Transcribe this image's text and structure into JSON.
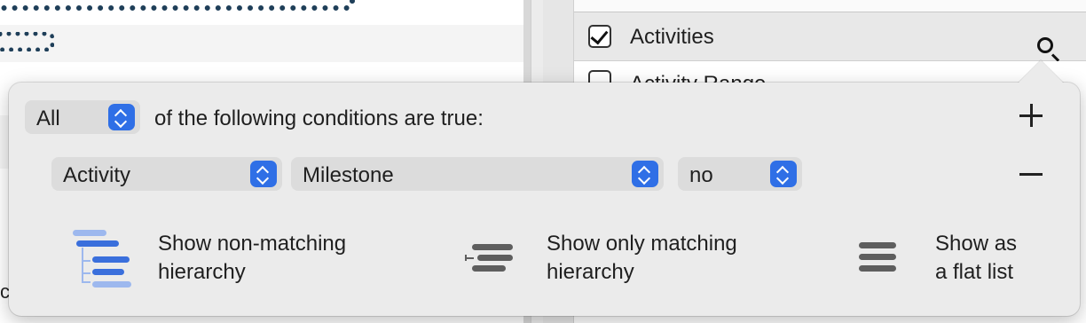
{
  "background": {
    "filter_list": {
      "active_item": "Activities",
      "active_checked": true,
      "next_item": "Activity Range"
    },
    "cut_text": "c"
  },
  "popover": {
    "quantifier": {
      "value": "All"
    },
    "conditions_text": "of the following conditions are true:",
    "rule": {
      "field": "Activity",
      "property": "Milestone",
      "value": "no"
    },
    "add_icon": "plus-icon",
    "remove_icon": "minus-icon",
    "display_options": [
      {
        "label_line1": "Show non-matching",
        "label_line2": "hierarchy",
        "icon": "hierarchy-outline-icon",
        "selected": true
      },
      {
        "label_line1": "Show only matching",
        "label_line2": "hierarchy",
        "icon": "matching-hierarchy-icon",
        "selected": false
      },
      {
        "label_line1": "Show as",
        "label_line2": "a flat list",
        "icon": "flat-list-icon",
        "selected": false
      }
    ]
  },
  "colors": {
    "accent": "#2f6fe6",
    "selected_icon": "#3a6fdc",
    "selected_icon_light": "#9db8ee",
    "inactive_icon": "#5e5e5e",
    "popover_bg": "#ebebeb"
  }
}
